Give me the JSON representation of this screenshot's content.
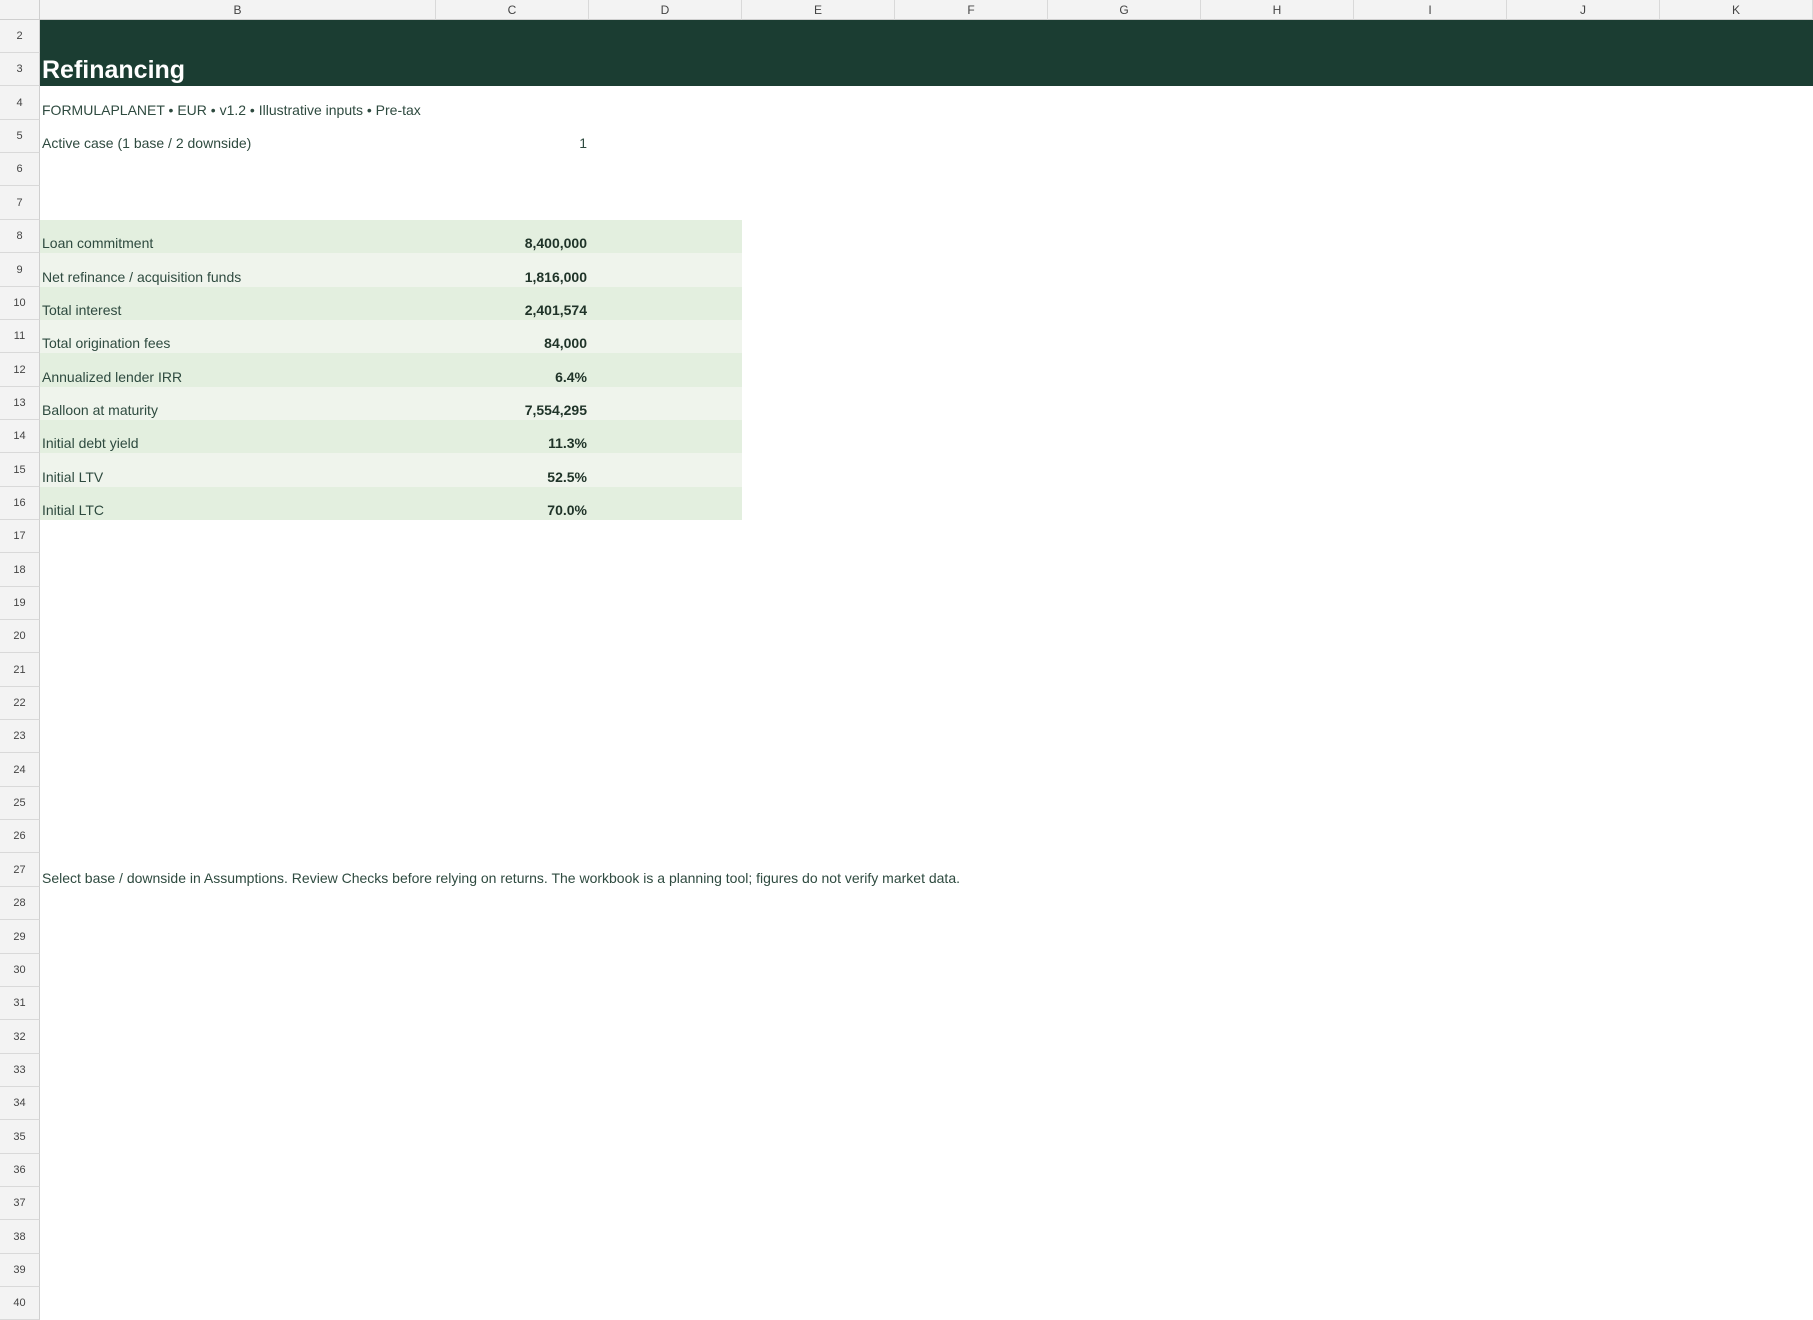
{
  "columns": [
    "B",
    "C",
    "D",
    "E",
    "F",
    "G",
    "H",
    "I",
    "J",
    "K"
  ],
  "rows": [
    "2",
    "3",
    "4",
    "5",
    "6",
    "7",
    "8",
    "9",
    "10",
    "11",
    "12",
    "13",
    "14",
    "15",
    "16",
    "17",
    "18",
    "19",
    "20",
    "21",
    "22",
    "23",
    "24",
    "25",
    "26",
    "27",
    "28",
    "29",
    "30",
    "31",
    "32",
    "33",
    "34",
    "35",
    "36",
    "37",
    "38",
    "39",
    "40"
  ],
  "sheet": {
    "title": "Refinancing",
    "subtitle": "FORMULAPLANET  •  EUR  •  v1.2  •  Illustrative inputs  •  Pre-tax",
    "active_case_label": "Active case (1 base / 2 downside)",
    "active_case_value": "1",
    "metrics": [
      {
        "label": "Loan commitment",
        "value": "8,400,000"
      },
      {
        "label": "Net refinance / acquisition funds",
        "value": "1,816,000"
      },
      {
        "label": "Total interest",
        "value": "2,401,574"
      },
      {
        "label": "Total origination fees",
        "value": "84,000"
      },
      {
        "label": "Annualized lender IRR",
        "value": "6.4%"
      },
      {
        "label": "Balloon at maturity",
        "value": "7,554,295"
      },
      {
        "label": "Initial debt yield",
        "value": "11.3%"
      },
      {
        "label": "Initial LTV",
        "value": "52.5%"
      },
      {
        "label": "Initial LTC",
        "value": "70.0%"
      }
    ],
    "note": "Select base / downside in Assumptions. Review Checks before relying on returns. The workbook is a planning tool; figures do not verify market data."
  },
  "colors": {
    "banner": "#1b3d32",
    "band_dark": "#e3efdf",
    "band_light": "#eff4ec",
    "text": "#2e4a3f"
  }
}
